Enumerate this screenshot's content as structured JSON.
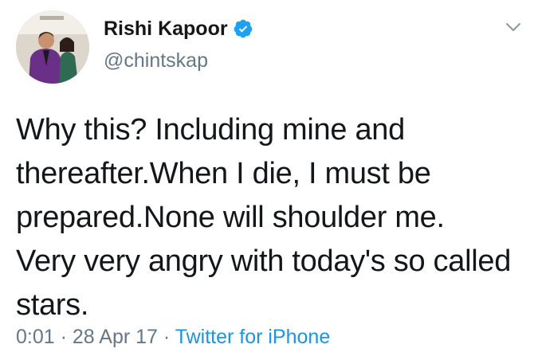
{
  "author": {
    "display_name": "Rishi Kapoor",
    "handle": "@chintskap",
    "verified": true,
    "avatar_icon": "profile-photo",
    "verified_icon": "verified-badge-icon",
    "verified_color": "#1da1f2"
  },
  "tweet": {
    "lines": [
      "Why this? Including mine and",
      "thereafter.When I die, I must be",
      "prepared.None will shoulder me.",
      "Very very angry with today's so called",
      "stars."
    ]
  },
  "meta": {
    "time": "0:01",
    "separator": " · ",
    "date": "28 Apr 17",
    "source": "Twitter for iPhone"
  },
  "menu": {
    "caret_icon": "chevron-down-icon"
  },
  "colors": {
    "text": "#14171a",
    "secondary": "#657786",
    "link": "#1b95e0"
  }
}
